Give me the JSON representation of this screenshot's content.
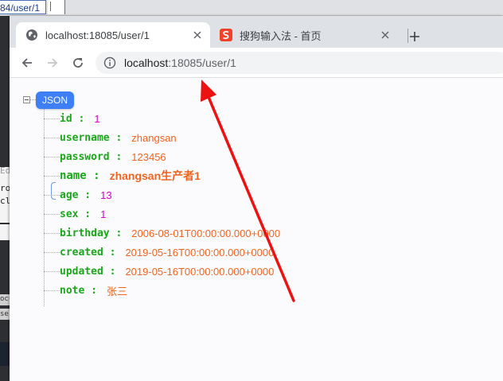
{
  "background": {
    "url_fragment": "84/user/1",
    "side_texts": [
      "Ed",
      "ro",
      "cl",
      "ocu",
      "se"
    ]
  },
  "browser": {
    "tabs": [
      {
        "title": "localhost:18085/user/1",
        "icon": "globe-icon",
        "active": true
      },
      {
        "title": "搜狗输入法 - 首页",
        "icon": "sogou-icon",
        "active": false
      }
    ],
    "new_tab_icon": "plus-icon",
    "address": {
      "host": "localhost",
      "rest": ":18085/user/1"
    },
    "colors": {
      "tabstrip": "#dee1e6",
      "accent": "#3f7ff6",
      "sogou": "#f0412b"
    }
  },
  "json_viewer": {
    "root_label": "JSON",
    "fields": [
      {
        "key": "id :",
        "value": "1",
        "type": "num"
      },
      {
        "key": "username :",
        "value": "zhangsan",
        "type": "str"
      },
      {
        "key": "password :",
        "value": "123456",
        "type": "str"
      },
      {
        "key": "name :",
        "value": "zhangsan生产者1",
        "type": "str",
        "highlighted": true
      },
      {
        "key": "age :",
        "value": "13",
        "type": "num"
      },
      {
        "key": "sex :",
        "value": "1",
        "type": "num"
      },
      {
        "key": "birthday :",
        "value": "2006-08-01T00:00:00.000+0000",
        "type": "str"
      },
      {
        "key": "created :",
        "value": "2019-05-16T00:00:00.000+0000",
        "type": "str"
      },
      {
        "key": "updated :",
        "value": "2019-05-16T00:00:00.000+0000",
        "type": "str"
      },
      {
        "key": "note :",
        "value": "张三",
        "type": "str"
      }
    ],
    "colors": {
      "key": "#1aa81a",
      "string": "#f0641e",
      "number": "#d200d2"
    }
  },
  "annotation": {
    "arrow_color": "#ee1111"
  }
}
